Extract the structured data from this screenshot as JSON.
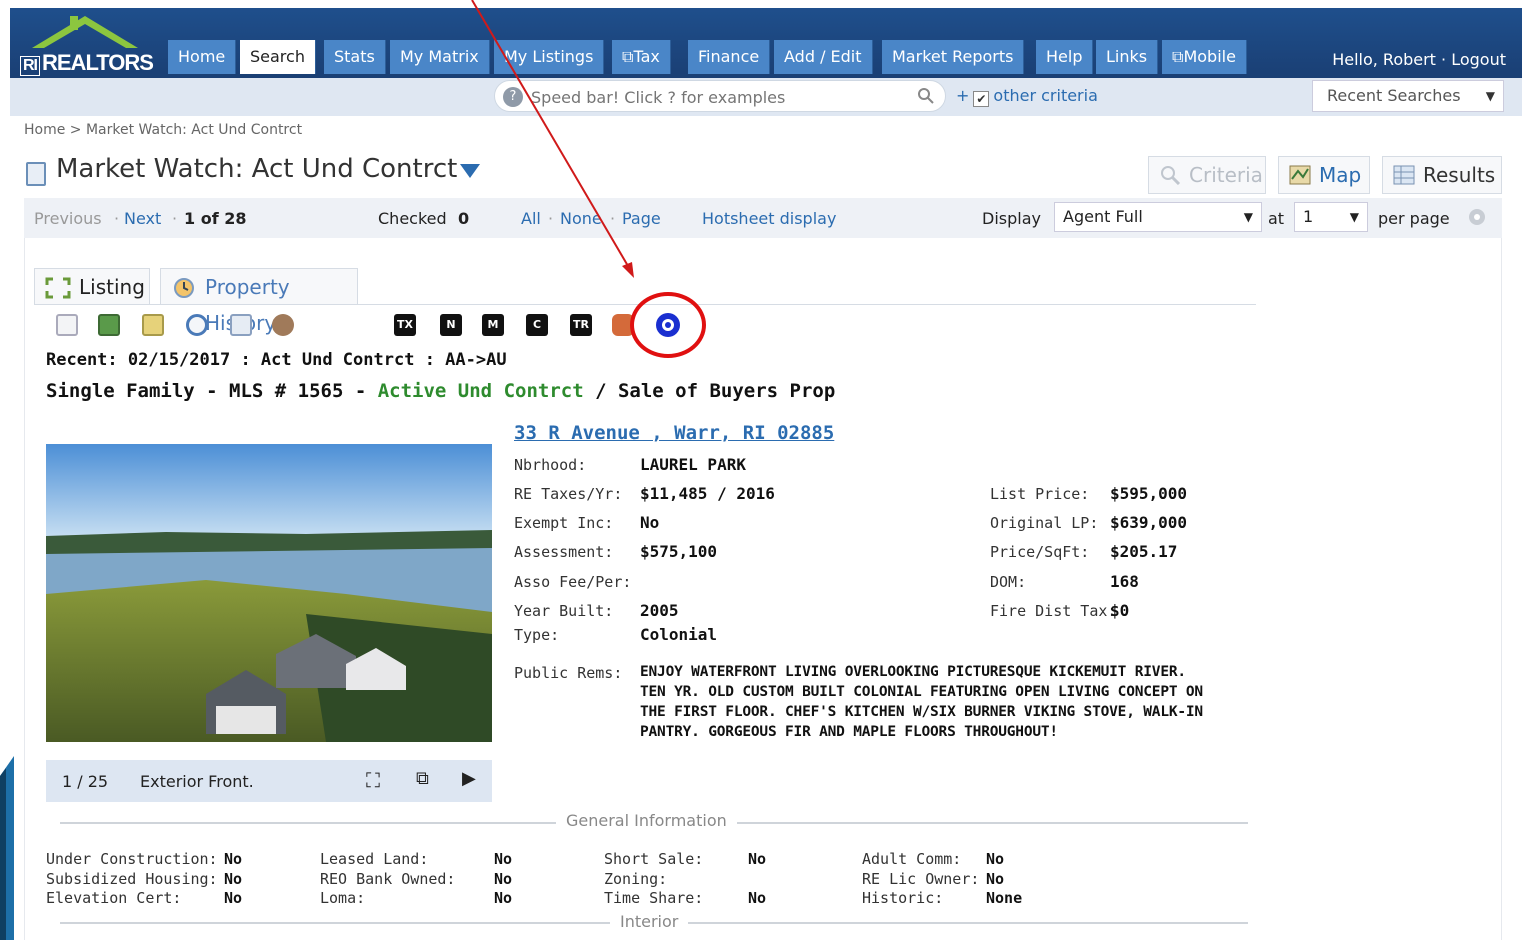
{
  "header": {
    "logo_text": "REALTORS",
    "logo_ri": "RI",
    "tabs": [
      {
        "label": "Home"
      },
      {
        "label": "Search"
      },
      {
        "label": "Stats"
      },
      {
        "label": "My Matrix"
      },
      {
        "label": "My Listings"
      },
      {
        "label": "Tax"
      },
      {
        "label": "Finance"
      },
      {
        "label": "Add / Edit"
      },
      {
        "label": "Market Reports"
      },
      {
        "label": "Help"
      },
      {
        "label": "Links"
      },
      {
        "label": "Mobile"
      }
    ],
    "active_tab": "Search",
    "greeting": "Hello, Robert · Logout"
  },
  "search": {
    "placeholder": "Speed bar! Click ? for examples",
    "other_criteria": "other criteria",
    "recent_searches": "Recent Searches"
  },
  "breadcrumb": "Home > Market Watch: Act Und Contrct",
  "page": {
    "title": "Market Watch: Act Und Contrct",
    "criteria_label": "Criteria",
    "map_label": "Map",
    "results_label": "Results"
  },
  "pager": {
    "previous": "Previous",
    "next": "Next",
    "position": "1 of 28",
    "checked_label": "Checked",
    "checked_count": "0",
    "all": "All",
    "none": "None",
    "page": "Page",
    "hotsheet": "Hotsheet display",
    "display_label": "Display",
    "display_value": "Agent Full",
    "at_label": "at",
    "at_value": "1",
    "per_page": "per page"
  },
  "tabs": {
    "listing": "Listing",
    "history": "Property History"
  },
  "tools": {
    "tx": "TX",
    "n": "N",
    "m": "M",
    "c": "C",
    "tr": "TR"
  },
  "listing": {
    "recent": "Recent:  02/15/2017 : Act Und Contrct : AA->AU",
    "type_prefix": "Single Family - MLS # 1565 - ",
    "status": "Active Und Contrct",
    "type_suffix": " / Sale of Buyers Prop",
    "address": "33 R Avenue , Warr, RI 02885",
    "photo_index": "1 / 25",
    "photo_caption": "Exterior Front.",
    "fields_left": [
      {
        "label": "Nbrhood:",
        "value": "LAUREL PARK"
      },
      {
        "label": "RE Taxes/Yr:",
        "value": "$11,485 / 2016"
      },
      {
        "label": "Exempt Inc:",
        "value": "No"
      },
      {
        "label": "Assessment:",
        "value": "$575,100"
      },
      {
        "label": "Asso Fee/Per:",
        "value": ""
      },
      {
        "label": "Year Built:",
        "value": "2005"
      },
      {
        "label": "Type:",
        "value": "Colonial"
      }
    ],
    "fields_right": [
      {
        "label": "List Price:",
        "value": "$595,000"
      },
      {
        "label": "Original LP:",
        "value": "$639,000"
      },
      {
        "label": "Price/SqFt:",
        "value": "$205.17"
      },
      {
        "label": "DOM:",
        "value": "168"
      },
      {
        "label": "Fire Dist Tax:",
        "value": "$0"
      }
    ],
    "public_rems_label": "Public Rems:",
    "public_rems": "ENJOY WATERFRONT LIVING OVERLOOKING PICTURESQUE KICKEMUIT RIVER. TEN YR. OLD CUSTOM BUILT COLONIAL FEATURING OPEN LIVING CONCEPT ON THE FIRST FLOOR. CHEF'S KITCHEN W/SIX BURNER VIKING STOVE, WALK-IN PANTRY. GORGEOUS FIR AND MAPLE FLOORS THROUGHOUT!"
  },
  "general": {
    "title": "General Information",
    "col1": [
      {
        "label": "Under Construction:",
        "value": "No"
      },
      {
        "label": "Subsidized Housing:",
        "value": "No"
      },
      {
        "label": "Elevation Cert:",
        "value": "No"
      }
    ],
    "col2": [
      {
        "label": "Leased Land:",
        "value": "No"
      },
      {
        "label": "REO Bank Owned:",
        "value": "No"
      },
      {
        "label": "Loma:",
        "value": "No"
      }
    ],
    "col3": [
      {
        "label": "Short Sale:",
        "value": "No"
      },
      {
        "label": "Zoning:",
        "value": ""
      },
      {
        "label": "Time Share:",
        "value": "No"
      }
    ],
    "col4": [
      {
        "label": "Adult Comm:",
        "value": "No"
      },
      {
        "label": "RE Lic Owner:",
        "value": "No"
      },
      {
        "label": "Historic:",
        "value": "None"
      }
    ]
  },
  "interior": {
    "title": "Interior"
  },
  "colors": {
    "nav_bg": "#1a3f74",
    "tab_bg": "#4a86c8",
    "link": "#2b6cb0",
    "status_green": "#2e8b2e",
    "highlight_red": "#e01010"
  }
}
